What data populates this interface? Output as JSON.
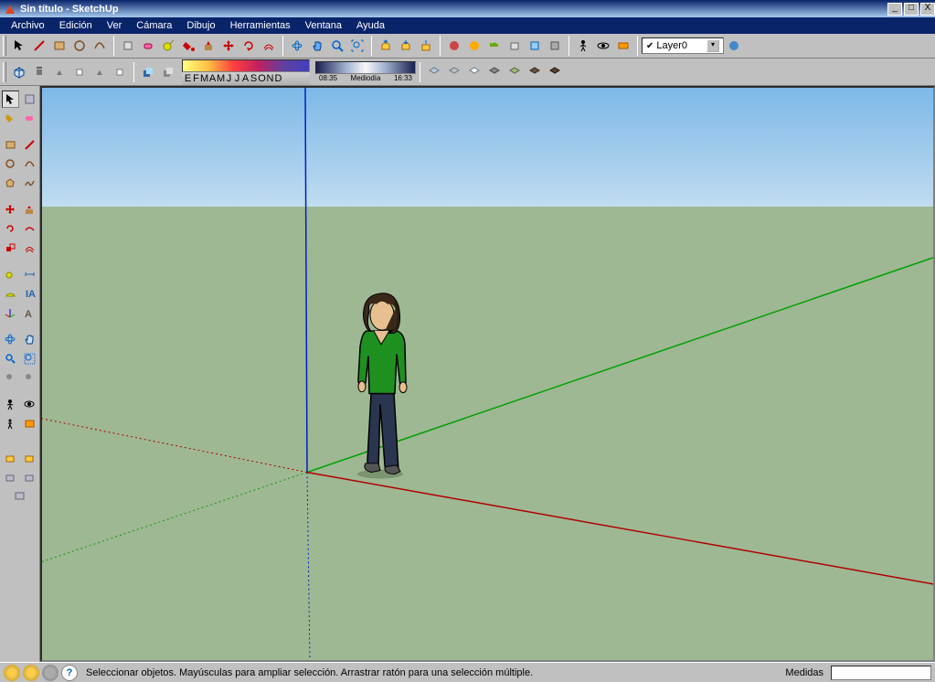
{
  "title": "Sin título - SketchUp",
  "menu": [
    "Archivo",
    "Edición",
    "Ver",
    "Cámara",
    "Dibujo",
    "Herramientas",
    "Ventana",
    "Ayuda"
  ],
  "layer_selected": "Layer0",
  "shadow": {
    "months": [
      "E",
      "F",
      "M",
      "A",
      "M",
      "J",
      "J",
      "A",
      "S",
      "O",
      "N",
      "D"
    ],
    "time_left": "08:35",
    "time_mid": "Mediodía",
    "time_right": "16:33"
  },
  "status_hint": "Seleccionar objetos. Mayúsculas para ampliar selección. Arrastrar ratón para una selección múltiple.",
  "measure_label": "Medidas",
  "help_icon": "?",
  "win_btns": {
    "min": "_",
    "max": "□",
    "close": "X"
  }
}
